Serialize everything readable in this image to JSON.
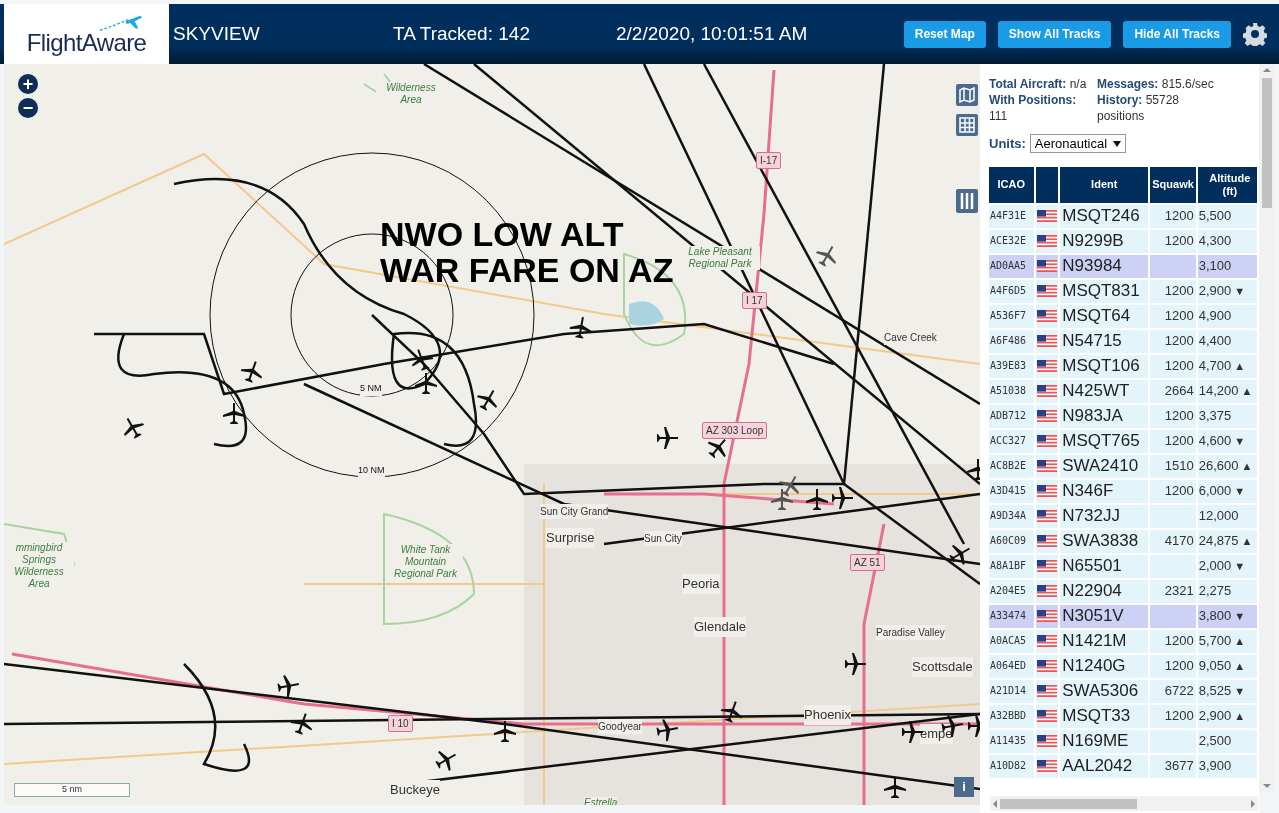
{
  "header": {
    "logo": "FlightAware",
    "app_name": "SKYVIEW",
    "tracked": "TA Tracked: 142",
    "datetime": "2/2/2020, 10:01:51 AM",
    "buttons": [
      "Reset Map",
      "Show All Tracks",
      "Hide All Tracks"
    ]
  },
  "map": {
    "zoom_in": "+",
    "zoom_out": "−",
    "annotation": [
      "NWO LOW ALT",
      "WAR FARE ON AZ"
    ],
    "scale": "5 nm",
    "info": "i",
    "labels": [
      {
        "text": "Wilderness Area",
        "kind": "park"
      },
      {
        "text": "I-17",
        "kind": "shield"
      },
      {
        "text": "Lake Pleasant Regional Park",
        "kind": "park"
      },
      {
        "text": "I 17",
        "kind": "shield"
      },
      {
        "text": "Cave Creek",
        "kind": "place"
      },
      {
        "text": "AZ 303 Loop",
        "kind": "shield"
      },
      {
        "text": "5 NM",
        "kind": "ring"
      },
      {
        "text": "10 NM",
        "kind": "ring"
      },
      {
        "text": "mmingbird Springs Wilderness Area",
        "kind": "park"
      },
      {
        "text": "Sun City Grand",
        "kind": "place"
      },
      {
        "text": "Surprise",
        "kind": "city"
      },
      {
        "text": "Sun City",
        "kind": "place"
      },
      {
        "text": "White Tank Mountain Regional Park",
        "kind": "park"
      },
      {
        "text": "Peoria",
        "kind": "city"
      },
      {
        "text": "AZ 51",
        "kind": "shield"
      },
      {
        "text": "Glendale",
        "kind": "city"
      },
      {
        "text": "Paradise Valley",
        "kind": "place"
      },
      {
        "text": "Scottsdale",
        "kind": "city"
      },
      {
        "text": "Phoenix",
        "kind": "city"
      },
      {
        "text": "I 10",
        "kind": "shield"
      },
      {
        "text": "Goodyear",
        "kind": "place"
      },
      {
        "text": "empe",
        "kind": "city"
      },
      {
        "text": "Buckeye",
        "kind": "city"
      },
      {
        "text": "Estrella",
        "kind": "park"
      }
    ]
  },
  "stats": {
    "total_label": "Total Aircraft:",
    "total_value": "n/a",
    "messages_label": "Messages:",
    "messages_value": "815.6/sec",
    "positions_label": "With Positions:",
    "positions_value": "111",
    "history_label": "History:",
    "history_value": "55728 positions"
  },
  "units": {
    "label": "Units:",
    "value": "Aeronautical"
  },
  "table": {
    "columns": [
      "ICAO",
      "",
      "Ident",
      "Squawk",
      "Altitude (ft)"
    ],
    "rows": [
      {
        "icao": "A4F31E",
        "ident": "MSQT246",
        "squawk": "1200",
        "altitude": "5,500",
        "selected": false
      },
      {
        "icao": "ACE32E",
        "ident": "N9299B",
        "squawk": "1200",
        "altitude": "4,300",
        "selected": false
      },
      {
        "icao": "AD0AA5",
        "ident": "N93984",
        "squawk": "",
        "altitude": "3,100",
        "selected": true
      },
      {
        "icao": "A4F6D5",
        "ident": "MSQT831",
        "squawk": "1200",
        "altitude": "2,900",
        "trend": "▼",
        "selected": false
      },
      {
        "icao": "A536F7",
        "ident": "MSQT64",
        "squawk": "1200",
        "altitude": "4,900",
        "selected": false
      },
      {
        "icao": "A6F486",
        "ident": "N54715",
        "squawk": "1200",
        "altitude": "4,400",
        "selected": false
      },
      {
        "icao": "A39E83",
        "ident": "MSQT106",
        "squawk": "1200",
        "altitude": "4,700",
        "trend": "▲",
        "selected": false
      },
      {
        "icao": "A51038",
        "ident": "N425WT",
        "squawk": "2664",
        "altitude": "14,200",
        "trend": "▲",
        "selected": false
      },
      {
        "icao": "ADB712",
        "ident": "N983JA",
        "squawk": "1200",
        "altitude": "3,375",
        "selected": false
      },
      {
        "icao": "ACC327",
        "ident": "MSQT765",
        "squawk": "1200",
        "altitude": "4,600",
        "trend": "▼",
        "selected": false
      },
      {
        "icao": "AC8B2E",
        "ident": "SWA2410",
        "squawk": "1510",
        "altitude": "26,600",
        "trend": "▲",
        "selected": false
      },
      {
        "icao": "A3D415",
        "ident": "N346F",
        "squawk": "1200",
        "altitude": "6,000",
        "trend": "▼",
        "selected": false
      },
      {
        "icao": "A9D34A",
        "ident": "N732JJ",
        "squawk": "",
        "altitude": "12,000",
        "selected": false
      },
      {
        "icao": "A60C09",
        "ident": "SWA3838",
        "squawk": "4170",
        "altitude": "24,875",
        "trend": "▲",
        "selected": false
      },
      {
        "icao": "A8A1BF",
        "ident": "N65501",
        "squawk": "",
        "altitude": "2,000",
        "trend": "▼",
        "selected": false
      },
      {
        "icao": "A204E5",
        "ident": "N22904",
        "squawk": "2321",
        "altitude": "2,275",
        "selected": false
      },
      {
        "icao": "A33474",
        "ident": "N3051V",
        "squawk": "",
        "altitude": "3,800",
        "trend": "▼",
        "selected": true
      },
      {
        "icao": "A0ACA5",
        "ident": "N1421M",
        "squawk": "1200",
        "altitude": "5,700",
        "trend": "▲",
        "selected": false
      },
      {
        "icao": "A064ED",
        "ident": "N1240G",
        "squawk": "1200",
        "altitude": "9,050",
        "trend": "▲",
        "selected": false
      },
      {
        "icao": "A21D14",
        "ident": "SWA5306",
        "squawk": "6722",
        "altitude": "8,525",
        "trend": "▼",
        "selected": false
      },
      {
        "icao": "A32BBD",
        "ident": "MSQT33",
        "squawk": "1200",
        "altitude": "2,900",
        "trend": "▲",
        "selected": false
      },
      {
        "icao": "A11435",
        "ident": "N169ME",
        "squawk": "",
        "altitude": "2,500",
        "selected": false
      },
      {
        "icao": "A10D82",
        "ident": "AAL2042",
        "squawk": "3677",
        "altitude": "3,900",
        "selected": false
      }
    ]
  }
}
